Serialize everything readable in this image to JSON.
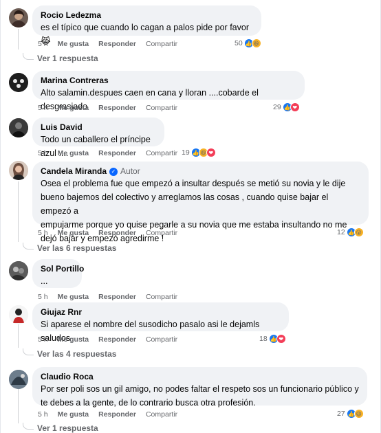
{
  "actions": {
    "time": "5 h",
    "like": "Me gusta",
    "reply": "Responder",
    "share": "Compartir"
  },
  "comments": [
    {
      "author": "Rocio Ledezma",
      "text": "es el típico que cuando lo cagan a palos pide por favor 😹",
      "count": "50",
      "reactions": [
        "like",
        "haha"
      ],
      "replies": "Ver 1 respuesta"
    },
    {
      "author": "Marina Contreras",
      "text": "Alto salamin.despues caen en cana y lloran ....cobarde el desgrasiado",
      "count": "29",
      "reactions": [
        "like",
        "love"
      ],
      "replies": ""
    },
    {
      "author": "Luis David",
      "text": "Todo un caballero el príncipe azul ....",
      "count": "19",
      "reactions": [
        "like",
        "haha",
        "love"
      ],
      "replies": ""
    },
    {
      "author": "Candela Miranda",
      "badge": "Autor",
      "verified": true,
      "lines": [
        "Osea el problema fue que empezó a insultar después se metió su novia y le dije",
        "bueno bajemos del colectivo y arreglamos las cosas , cuando quise bajar el empezó a",
        "empujarme porque yo quise pegarle a su novia que me estaba insultando no me",
        "dejó bajar y empezó agredirme !"
      ],
      "count": "12",
      "reactions": [
        "like",
        "wow"
      ],
      "replies": "Ver las 6 respuestas"
    },
    {
      "author": "Sol Portillo",
      "text": "...",
      "count": "",
      "reactions": [],
      "replies": ""
    },
    {
      "author": "Giujaz Rnr",
      "text": "Si aparese el nombre del susodicho pasalo asi le dejamls saludos",
      "count": "18",
      "reactions": [
        "like",
        "love"
      ],
      "replies": "Ver las 4 respuestas"
    },
    {
      "author": "Claudio Roca",
      "lines": [
        "Por ser poli sos un gil amigo, no podes faltar el respeto sos un funcionario público y",
        "te debes a la gente, de lo contrario busca otra profesión."
      ],
      "count": "27",
      "reactions": [
        "like",
        "haha"
      ],
      "replies": "Ver 1 respuesta"
    }
  ],
  "reaction_icons": {
    "like": "thumbs-up-icon",
    "haha": "laughing-face-icon",
    "love": "heart-icon",
    "wow": "wow-face-icon"
  },
  "reaction_glyphs": {
    "like": "👍",
    "haha": "😆",
    "love": "❤",
    "wow": "😮"
  }
}
